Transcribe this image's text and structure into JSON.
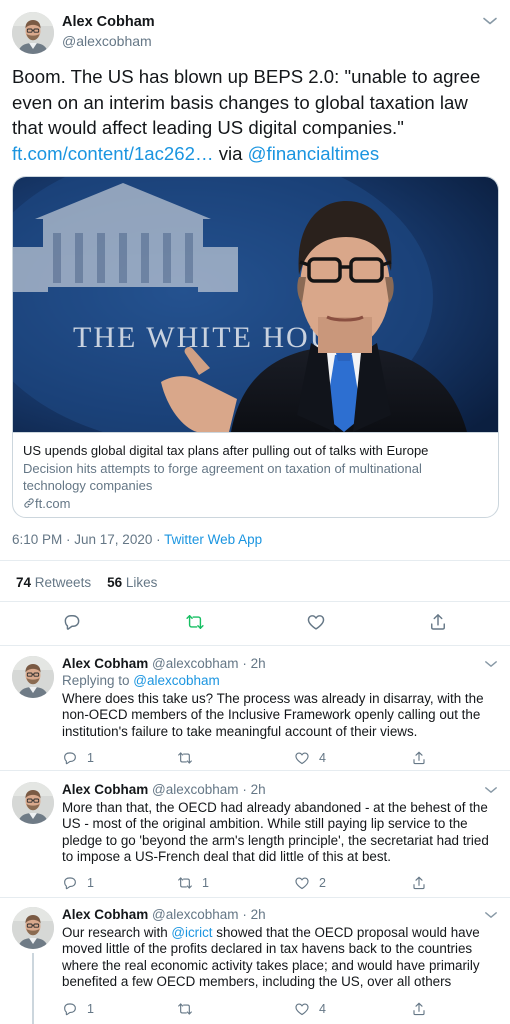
{
  "main_tweet": {
    "author_name": "Alex Cobham",
    "author_handle": "@alexcobham",
    "text_line1": "Boom. The US has blown up BEPS 2.0: \"unable to agree",
    "text_line2": "even on an interim basis changes to global taxation law",
    "text_line3": "that would affect leading US digital companies.\"",
    "link_text": "ft.com/content/1ac262…",
    "via_text": " via ",
    "mention": "@financialtimes",
    "card": {
      "image_sign_text": "THE WHITE HOUSE",
      "title": "US upends global digital tax plans after pulling out of talks with Europe",
      "description_line1": "Decision hits attempts to forge agreement on taxation of multinational",
      "description_line2": "technology companies",
      "domain": "ft.com"
    },
    "timestamp": "6:10 PM · Jun 17, 2020 · ",
    "source": "Twitter Web App",
    "retweets_count": "74",
    "retweets_label": "Retweets",
    "likes_count": "56",
    "likes_label": "Likes"
  },
  "replies": [
    {
      "author_name": "Alex Cobham",
      "author_handle": "@alexcobham",
      "dot": "·",
      "time": "2h",
      "replying_prefix": "Replying to ",
      "replying_to": "@alexcobham",
      "line1": "Where does this take us? The process was already in disarray, with the",
      "line2": "non-OECD members of the Inclusive Framework openly calling out the",
      "line3": "institution's failure to take meaningful account of their views.",
      "line4": "",
      "reply_count": "1",
      "retweet_count": "",
      "like_count": "4"
    },
    {
      "author_name": "Alex Cobham",
      "author_handle": "@alexcobham",
      "dot": "·",
      "time": "2h",
      "line1": "More than that, the OECD had already abandoned - at the behest of the",
      "line2": "US - most of the original ambition. While still paying lip service to the",
      "line3": "pledge to go 'beyond the arm's length principle', the secretariat had tried",
      "line4": "to impose a US-French deal that did little of this at best.",
      "reply_count": "1",
      "retweet_count": "1",
      "like_count": "2"
    },
    {
      "author_name": "Alex Cobham",
      "author_handle": "@alexcobham",
      "dot": "·",
      "time": "2h",
      "line1_prefix": "Our research with ",
      "line1_mention": "@icrict",
      "line1_suffix": " showed that the OECD proposal would have",
      "line2": "moved little of the profits declared in tax havens back to the countries",
      "line3": "where the real economic activity takes place; and would have primarily",
      "line4": "benefited a few OECD members, including the US, over all others",
      "reply_count": "1",
      "retweet_count": "",
      "like_count": "4"
    }
  ],
  "colors": {
    "link": "#1b95e0",
    "secondary_text": "#657786",
    "retweet_active": "#17bf63",
    "border": "#ccd6dd"
  },
  "icons": [
    "chevron-down-icon",
    "reply-icon",
    "retweet-icon",
    "like-icon",
    "share-icon",
    "link-icon"
  ]
}
